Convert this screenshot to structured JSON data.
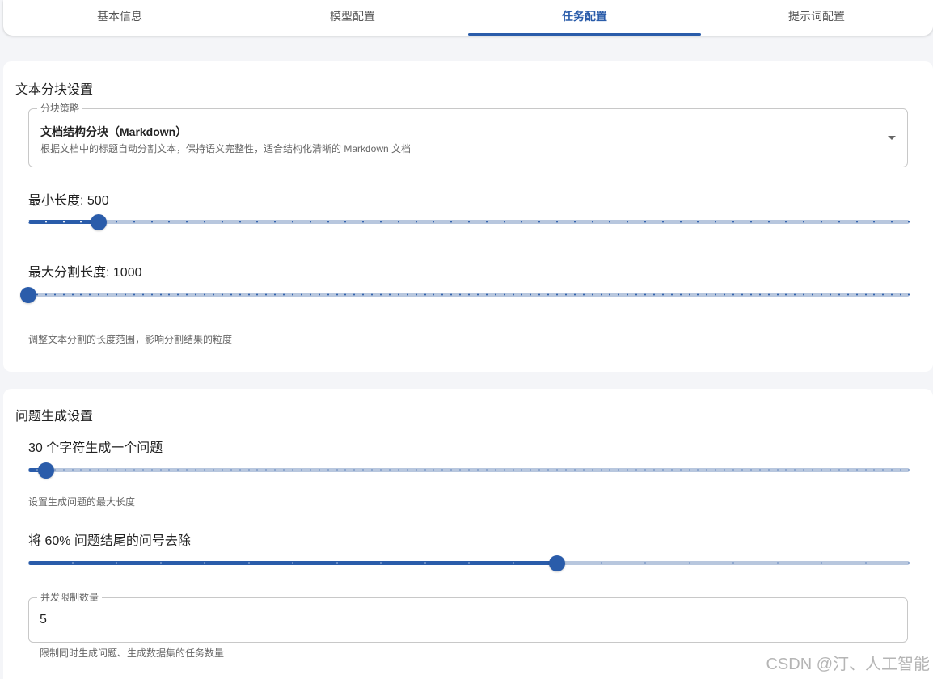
{
  "tabs": [
    {
      "label": "基本信息"
    },
    {
      "label": "模型配置"
    },
    {
      "label": "任务配置"
    },
    {
      "label": "提示词配置"
    }
  ],
  "active_tab": "任务配置",
  "chunk_section": {
    "title": "文本分块设置",
    "strategy": {
      "legend": "分块策略",
      "selected_title": "文档结构分块（Markdown）",
      "selected_desc": "根据文档中的标题自动分割文本，保持语义完整性，适合结构化清晰的 Markdown 文档"
    },
    "min_length": {
      "label": "最小长度: 500",
      "fraction": 0.08,
      "ticks": 50
    },
    "max_length": {
      "label": "最大分割长度: 1000",
      "fraction": 0.0,
      "ticks": 100
    },
    "helper": "调整文本分割的长度范围，影响分割结果的粒度"
  },
  "question_section": {
    "title": "问题生成设置",
    "chars_per_question": {
      "label": "30 个字符生成一个问题",
      "fraction": 0.02,
      "ticks": 100
    },
    "chars_helper": "设置生成问题的最大长度",
    "remove_question_mark": {
      "label": "将 60% 问题结尾的问号去除",
      "fraction": 0.6,
      "ticks": 20
    },
    "concurrency": {
      "legend": "并发限制数量",
      "value": "5",
      "helper": "限制同时生成问题、生成数据集的任务数量"
    }
  },
  "watermark": "CSDN @汀、人工智能",
  "colors": {
    "accent": "#2a5caa",
    "track": "#b8c7de"
  }
}
